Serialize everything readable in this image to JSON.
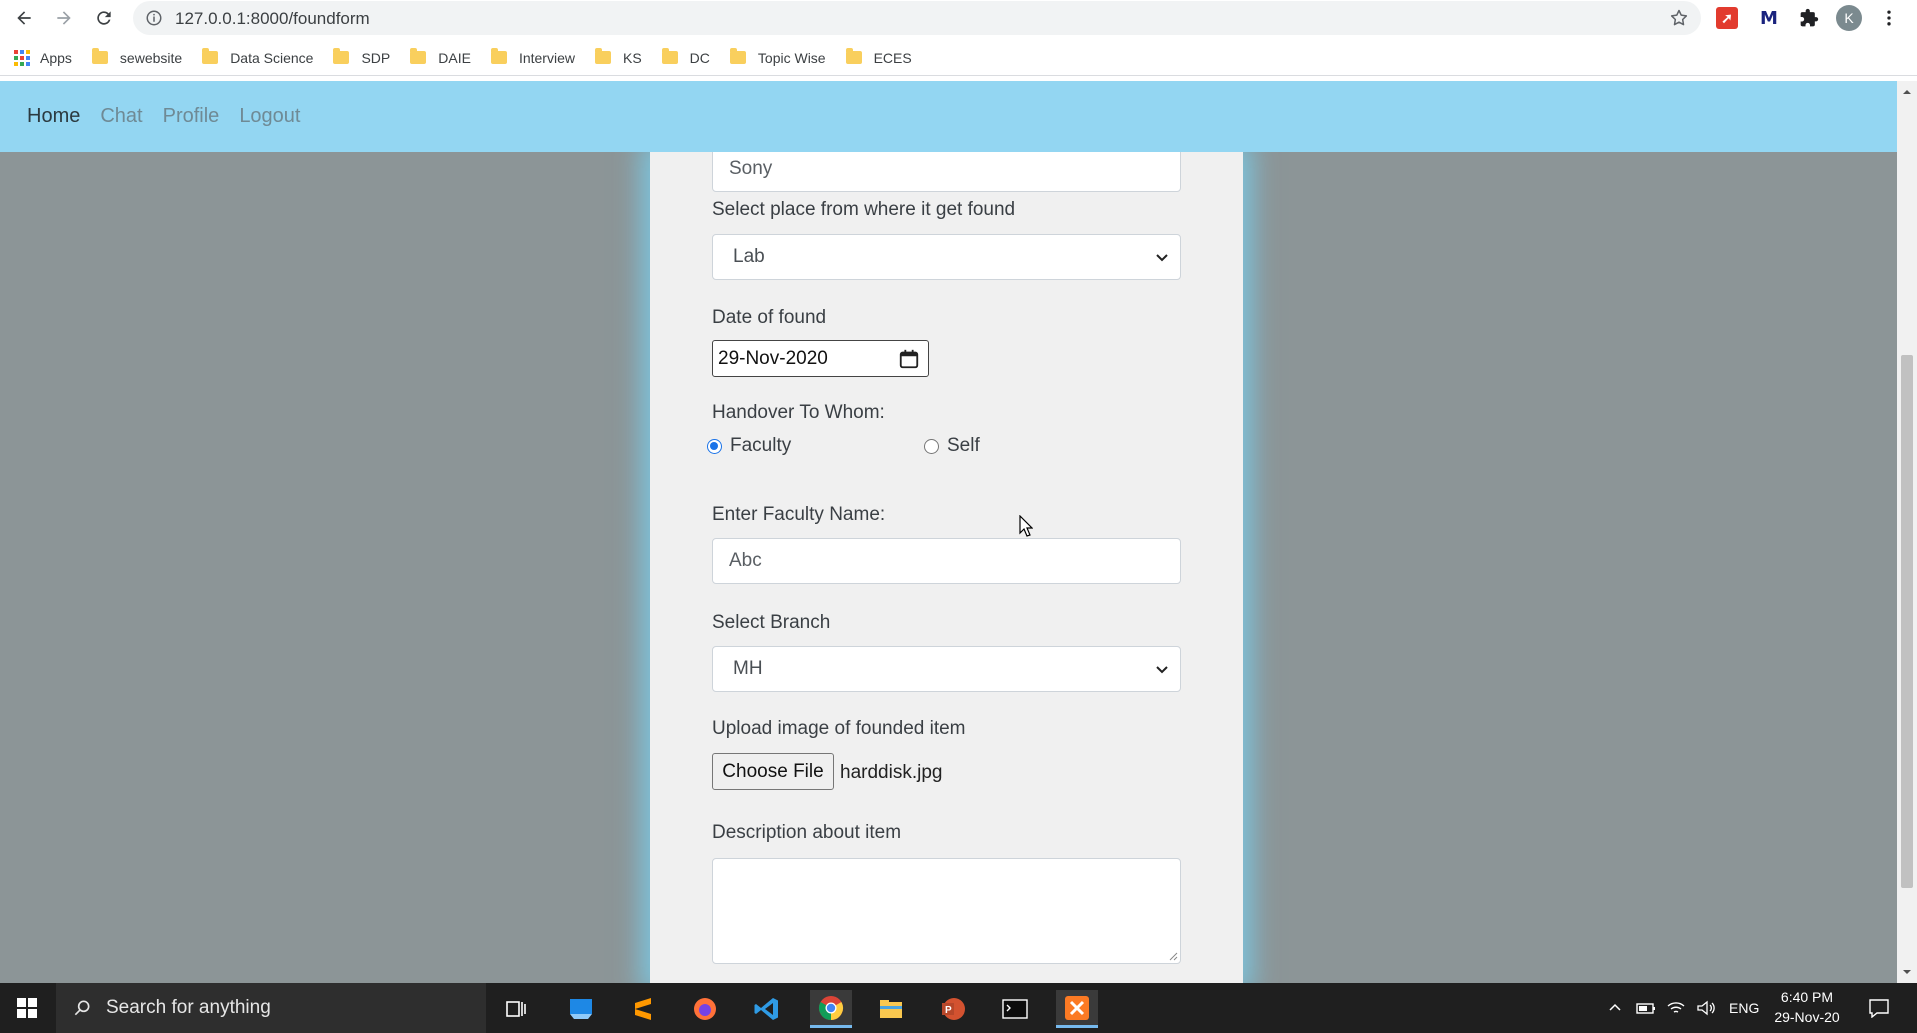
{
  "browser": {
    "url": "127.0.0.1:8000/foundform",
    "avatar_letter": "K",
    "ext_m_label": "M",
    "bookmarks": [
      {
        "label": "Apps",
        "icon": "apps-grid-icon"
      },
      {
        "label": "sewebsite",
        "icon": "folder-icon"
      },
      {
        "label": "Data Science",
        "icon": "folder-icon"
      },
      {
        "label": "SDP",
        "icon": "folder-icon"
      },
      {
        "label": "DAIE",
        "icon": "folder-icon"
      },
      {
        "label": "Interview",
        "icon": "folder-icon"
      },
      {
        "label": "KS",
        "icon": "folder-icon"
      },
      {
        "label": "DC",
        "icon": "folder-icon"
      },
      {
        "label": "Topic Wise",
        "icon": "folder-icon"
      },
      {
        "label": "ECES",
        "icon": "folder-icon"
      }
    ]
  },
  "navbar": {
    "items": [
      {
        "label": "Home",
        "active": true
      },
      {
        "label": "Chat",
        "active": false
      },
      {
        "label": "Profile",
        "active": false
      },
      {
        "label": "Logout",
        "active": false
      }
    ],
    "color": "#93d6f2"
  },
  "form": {
    "item_name_value": "Sony",
    "place_label": "Select place from where it get found",
    "place_value": "Lab",
    "date_label": "Date of found",
    "date_value": "29-Nov-2020",
    "handover_label": "Handover To Whom:",
    "handover_options": [
      {
        "label": "Faculty",
        "checked": true
      },
      {
        "label": "Self",
        "checked": false
      }
    ],
    "faculty_label": "Enter Faculty Name:",
    "faculty_value": "Abc",
    "branch_label": "Select Branch",
    "branch_value": "MH",
    "upload_label": "Upload image of founded item",
    "upload_button": "Choose File",
    "upload_filename": "harddisk.jpg",
    "description_label": "Description about item",
    "description_value": ""
  },
  "taskbar": {
    "search_placeholder": "Search for anything",
    "language": "ENG",
    "time": "6:40 PM",
    "date": "29-Nov-20",
    "apps": [
      "task-view-icon",
      "remote-desktop-icon",
      "sublime-text-icon",
      "firefox-icon",
      "vscode-icon",
      "chrome-icon",
      "file-explorer-icon",
      "powerpoint-icon",
      "terminal-icon",
      "xampp-icon"
    ]
  }
}
